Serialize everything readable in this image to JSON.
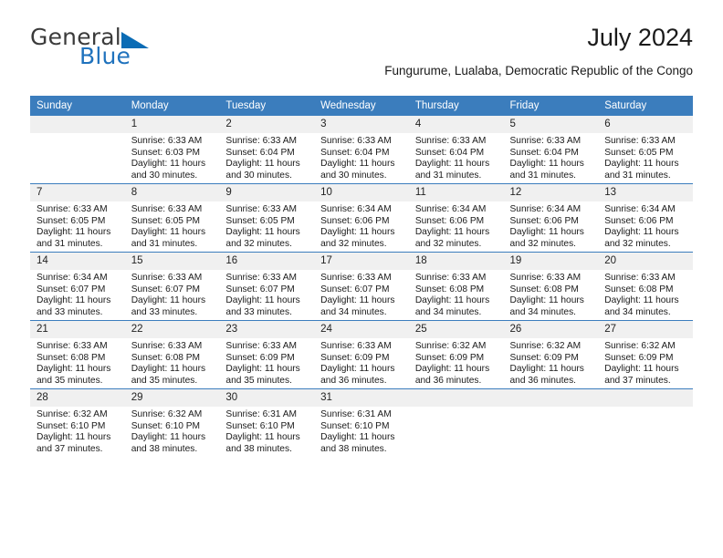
{
  "brand": {
    "name_top": "General",
    "name_bottom": "Blue",
    "triangle_icon": "blue-triangle-logo-mark",
    "color_top": "#3b3b3b",
    "color_bottom": "#1f72bd",
    "accent": "#0b6cb5"
  },
  "header": {
    "title": "July 2024",
    "subtitle": "Fungurume, Lualaba, Democratic Republic of the Congo"
  },
  "theme": {
    "header_row_bg": "#3b7dbd",
    "header_row_text": "#ffffff",
    "daynum_bg": "#f0f0f0",
    "row_divider": "#3b7dbd"
  },
  "weekdays": [
    "Sunday",
    "Monday",
    "Tuesday",
    "Wednesday",
    "Thursday",
    "Friday",
    "Saturday"
  ],
  "labels": {
    "sunrise_prefix": "Sunrise:",
    "sunset_prefix": "Sunset:",
    "daylight_prefix": "Daylight:"
  },
  "weeks": [
    {
      "days": [
        {
          "num": "",
          "blank": true,
          "line1": "",
          "line2": "",
          "line3": "",
          "line4": ""
        },
        {
          "num": "1",
          "blank": false,
          "line1": "Sunrise: 6:33 AM",
          "line2": "Sunset: 6:03 PM",
          "line3": "Daylight: 11 hours",
          "line4": "and 30 minutes."
        },
        {
          "num": "2",
          "blank": false,
          "line1": "Sunrise: 6:33 AM",
          "line2": "Sunset: 6:04 PM",
          "line3": "Daylight: 11 hours",
          "line4": "and 30 minutes."
        },
        {
          "num": "3",
          "blank": false,
          "line1": "Sunrise: 6:33 AM",
          "line2": "Sunset: 6:04 PM",
          "line3": "Daylight: 11 hours",
          "line4": "and 30 minutes."
        },
        {
          "num": "4",
          "blank": false,
          "line1": "Sunrise: 6:33 AM",
          "line2": "Sunset: 6:04 PM",
          "line3": "Daylight: 11 hours",
          "line4": "and 31 minutes."
        },
        {
          "num": "5",
          "blank": false,
          "line1": "Sunrise: 6:33 AM",
          "line2": "Sunset: 6:04 PM",
          "line3": "Daylight: 11 hours",
          "line4": "and 31 minutes."
        },
        {
          "num": "6",
          "blank": false,
          "line1": "Sunrise: 6:33 AM",
          "line2": "Sunset: 6:05 PM",
          "line3": "Daylight: 11 hours",
          "line4": "and 31 minutes."
        }
      ]
    },
    {
      "days": [
        {
          "num": "7",
          "blank": false,
          "line1": "Sunrise: 6:33 AM",
          "line2": "Sunset: 6:05 PM",
          "line3": "Daylight: 11 hours",
          "line4": "and 31 minutes."
        },
        {
          "num": "8",
          "blank": false,
          "line1": "Sunrise: 6:33 AM",
          "line2": "Sunset: 6:05 PM",
          "line3": "Daylight: 11 hours",
          "line4": "and 31 minutes."
        },
        {
          "num": "9",
          "blank": false,
          "line1": "Sunrise: 6:33 AM",
          "line2": "Sunset: 6:05 PM",
          "line3": "Daylight: 11 hours",
          "line4": "and 32 minutes."
        },
        {
          "num": "10",
          "blank": false,
          "line1": "Sunrise: 6:34 AM",
          "line2": "Sunset: 6:06 PM",
          "line3": "Daylight: 11 hours",
          "line4": "and 32 minutes."
        },
        {
          "num": "11",
          "blank": false,
          "line1": "Sunrise: 6:34 AM",
          "line2": "Sunset: 6:06 PM",
          "line3": "Daylight: 11 hours",
          "line4": "and 32 minutes."
        },
        {
          "num": "12",
          "blank": false,
          "line1": "Sunrise: 6:34 AM",
          "line2": "Sunset: 6:06 PM",
          "line3": "Daylight: 11 hours",
          "line4": "and 32 minutes."
        },
        {
          "num": "13",
          "blank": false,
          "line1": "Sunrise: 6:34 AM",
          "line2": "Sunset: 6:06 PM",
          "line3": "Daylight: 11 hours",
          "line4": "and 32 minutes."
        }
      ]
    },
    {
      "days": [
        {
          "num": "14",
          "blank": false,
          "line1": "Sunrise: 6:34 AM",
          "line2": "Sunset: 6:07 PM",
          "line3": "Daylight: 11 hours",
          "line4": "and 33 minutes."
        },
        {
          "num": "15",
          "blank": false,
          "line1": "Sunrise: 6:33 AM",
          "line2": "Sunset: 6:07 PM",
          "line3": "Daylight: 11 hours",
          "line4": "and 33 minutes."
        },
        {
          "num": "16",
          "blank": false,
          "line1": "Sunrise: 6:33 AM",
          "line2": "Sunset: 6:07 PM",
          "line3": "Daylight: 11 hours",
          "line4": "and 33 minutes."
        },
        {
          "num": "17",
          "blank": false,
          "line1": "Sunrise: 6:33 AM",
          "line2": "Sunset: 6:07 PM",
          "line3": "Daylight: 11 hours",
          "line4": "and 34 minutes."
        },
        {
          "num": "18",
          "blank": false,
          "line1": "Sunrise: 6:33 AM",
          "line2": "Sunset: 6:08 PM",
          "line3": "Daylight: 11 hours",
          "line4": "and 34 minutes."
        },
        {
          "num": "19",
          "blank": false,
          "line1": "Sunrise: 6:33 AM",
          "line2": "Sunset: 6:08 PM",
          "line3": "Daylight: 11 hours",
          "line4": "and 34 minutes."
        },
        {
          "num": "20",
          "blank": false,
          "line1": "Sunrise: 6:33 AM",
          "line2": "Sunset: 6:08 PM",
          "line3": "Daylight: 11 hours",
          "line4": "and 34 minutes."
        }
      ]
    },
    {
      "days": [
        {
          "num": "21",
          "blank": false,
          "line1": "Sunrise: 6:33 AM",
          "line2": "Sunset: 6:08 PM",
          "line3": "Daylight: 11 hours",
          "line4": "and 35 minutes."
        },
        {
          "num": "22",
          "blank": false,
          "line1": "Sunrise: 6:33 AM",
          "line2": "Sunset: 6:08 PM",
          "line3": "Daylight: 11 hours",
          "line4": "and 35 minutes."
        },
        {
          "num": "23",
          "blank": false,
          "line1": "Sunrise: 6:33 AM",
          "line2": "Sunset: 6:09 PM",
          "line3": "Daylight: 11 hours",
          "line4": "and 35 minutes."
        },
        {
          "num": "24",
          "blank": false,
          "line1": "Sunrise: 6:33 AM",
          "line2": "Sunset: 6:09 PM",
          "line3": "Daylight: 11 hours",
          "line4": "and 36 minutes."
        },
        {
          "num": "25",
          "blank": false,
          "line1": "Sunrise: 6:32 AM",
          "line2": "Sunset: 6:09 PM",
          "line3": "Daylight: 11 hours",
          "line4": "and 36 minutes."
        },
        {
          "num": "26",
          "blank": false,
          "line1": "Sunrise: 6:32 AM",
          "line2": "Sunset: 6:09 PM",
          "line3": "Daylight: 11 hours",
          "line4": "and 36 minutes."
        },
        {
          "num": "27",
          "blank": false,
          "line1": "Sunrise: 6:32 AM",
          "line2": "Sunset: 6:09 PM",
          "line3": "Daylight: 11 hours",
          "line4": "and 37 minutes."
        }
      ]
    },
    {
      "days": [
        {
          "num": "28",
          "blank": false,
          "line1": "Sunrise: 6:32 AM",
          "line2": "Sunset: 6:10 PM",
          "line3": "Daylight: 11 hours",
          "line4": "and 37 minutes."
        },
        {
          "num": "29",
          "blank": false,
          "line1": "Sunrise: 6:32 AM",
          "line2": "Sunset: 6:10 PM",
          "line3": "Daylight: 11 hours",
          "line4": "and 38 minutes."
        },
        {
          "num": "30",
          "blank": false,
          "line1": "Sunrise: 6:31 AM",
          "line2": "Sunset: 6:10 PM",
          "line3": "Daylight: 11 hours",
          "line4": "and 38 minutes."
        },
        {
          "num": "31",
          "blank": false,
          "line1": "Sunrise: 6:31 AM",
          "line2": "Sunset: 6:10 PM",
          "line3": "Daylight: 11 hours",
          "line4": "and 38 minutes."
        },
        {
          "num": "",
          "blank": true,
          "line1": "",
          "line2": "",
          "line3": "",
          "line4": ""
        },
        {
          "num": "",
          "blank": true,
          "line1": "",
          "line2": "",
          "line3": "",
          "line4": ""
        },
        {
          "num": "",
          "blank": true,
          "line1": "",
          "line2": "",
          "line3": "",
          "line4": ""
        }
      ]
    }
  ]
}
